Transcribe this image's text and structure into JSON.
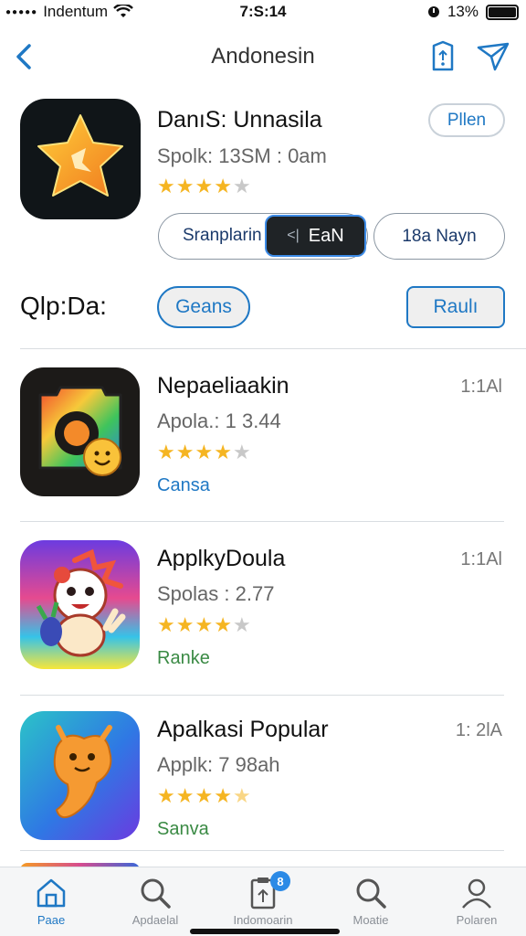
{
  "status_bar": {
    "carrier": "Indentum",
    "time": "7:S:14",
    "battery": "13%",
    "colors": {
      "text": "#111111"
    }
  },
  "nav": {
    "title": "Andonesin",
    "back_icon": "chevron-left-icon",
    "share_icon": "share-icon",
    "send_icon": "send-icon",
    "accent": "#1f78c4"
  },
  "featured": {
    "name": "DanıS: Unnasila",
    "meta": "Spolk: 13SM : 0am",
    "rating": 4,
    "open_label": "Pllen",
    "segment_left_label": "Sranplarin",
    "segment_active_label": "EaN",
    "segment_active_prefix": "<|",
    "pill_right_label": "18a Nayn",
    "icon": "star-app-icon"
  },
  "section": {
    "title": "Qlp:Da:",
    "category_button": "Geans",
    "rank_button": "Raulı"
  },
  "apps": [
    {
      "name": "Nepaeliaakin",
      "meta": "Apola.: 1  3.44",
      "rating": 4,
      "category": "Cansa",
      "category_color": "#1f78c4",
      "time": "1:1Al",
      "icon": "smile-camera-app-icon"
    },
    {
      "name": "ApplkyDoula",
      "meta": "Spolas  : 2.77",
      "rating": 4,
      "category": "Ranke",
      "category_color": "#3a8a44",
      "time": "1:1Al",
      "icon": "cartoon-character-app-icon"
    },
    {
      "name": "Apalkasi Popular",
      "meta": "Applk: 7  98ah",
      "rating": 4.5,
      "category": "Sanva",
      "category_color": "#3a8a44",
      "time": "1: 2lA",
      "icon": "orange-creature-app-icon"
    }
  ],
  "tab_bar": {
    "items": [
      {
        "label": "Paae",
        "icon": "home-icon",
        "active": true
      },
      {
        "label": "Apdaelal",
        "icon": "search-icon",
        "active": false
      },
      {
        "label": "Indomoarin",
        "icon": "clipboard-icon",
        "active": false,
        "badge": "8"
      },
      {
        "label": "Moatie",
        "icon": "search-icon",
        "active": false
      },
      {
        "label": "Polaren",
        "icon": "person-icon",
        "active": false
      }
    ],
    "active_color": "#1f78c4",
    "inactive_color": "#8a8f96"
  }
}
